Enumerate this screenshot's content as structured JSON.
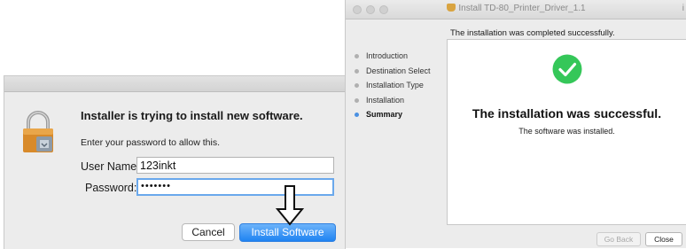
{
  "auth_dialog": {
    "heading": "Installer is trying to install new software.",
    "subtext": "Enter your password to allow this.",
    "username_label": "User Name:",
    "username_value": "123inkt",
    "password_label": "Password:",
    "password_value": "•••••••",
    "cancel_label": "Cancel",
    "install_label": "Install Software",
    "accent_color": "#1f83f2",
    "icon": "lock-icon"
  },
  "installer": {
    "title": "Install TD-80_Printer_Driver_1.1",
    "title_edge": "i",
    "completion_message": "The installation was completed successfully.",
    "steps": [
      {
        "label": "Introduction"
      },
      {
        "label": "Destination Select"
      },
      {
        "label": "Installation Type"
      },
      {
        "label": "Installation"
      },
      {
        "label": "Summary"
      }
    ],
    "active_step": "Summary",
    "success_heading": "The installation was successful.",
    "success_subtext": "The software was installed.",
    "go_back_label": "Go Back",
    "close_label": "Close",
    "success_color": "#35c759",
    "icon": "checkmark-circle-icon"
  }
}
